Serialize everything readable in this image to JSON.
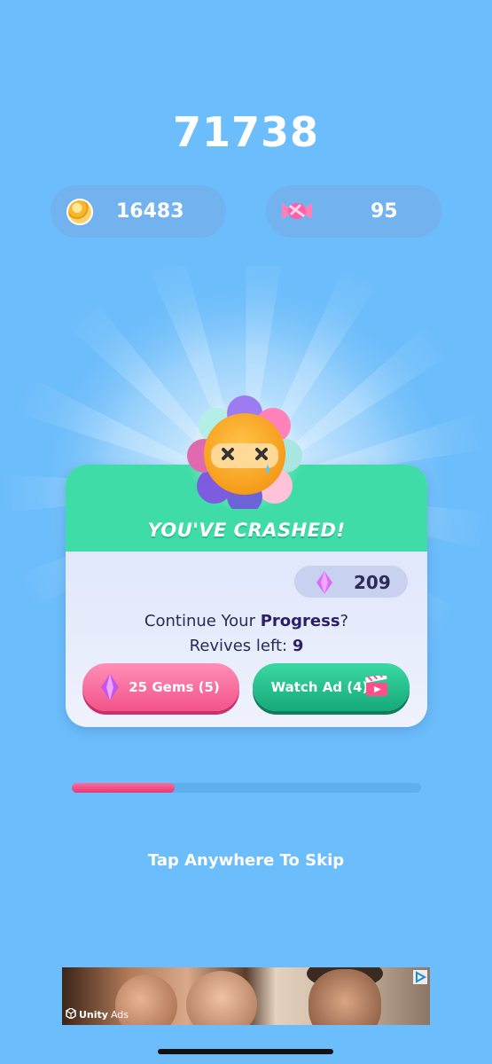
{
  "score": "71738",
  "currencies": {
    "coins": {
      "icon": "coin-icon",
      "value": "16483"
    },
    "candy": {
      "icon": "candy-icon",
      "value": "95"
    }
  },
  "dialog": {
    "title": "YOU'VE CRASHED!",
    "gems_balance": {
      "icon": "gem-icon",
      "value": "209"
    },
    "continue_prefix": "Continue Your ",
    "continue_bold": "Progress",
    "continue_suffix": "?",
    "revives_label": "Revives left: ",
    "revives_value": "9",
    "gems_button": "25 Gems (5)",
    "ad_button": "Watch Ad (4)"
  },
  "progress": {
    "fraction": 0.295
  },
  "skip_text": "Tap Anywhere To Skip",
  "ad": {
    "brand": "Unity",
    "label": "Ads"
  },
  "colors": {
    "background": "#6cbdfb",
    "header_green": "#3fdca8",
    "pink_button": "#f2538a",
    "green_button": "#16a979",
    "progress_fill": "#e23a74"
  }
}
